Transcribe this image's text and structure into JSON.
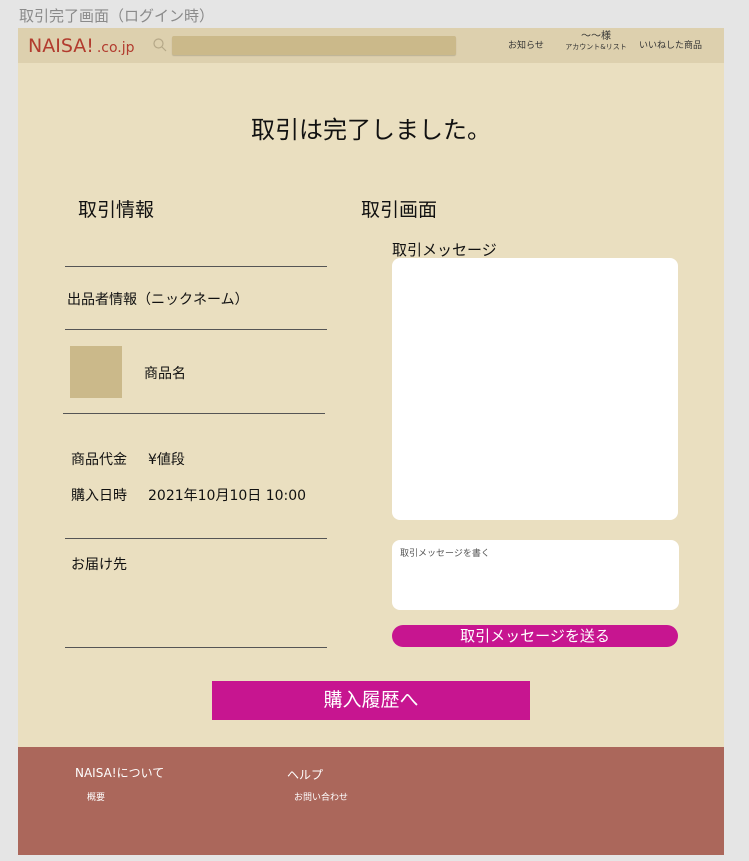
{
  "frame_label": "取引完了画面（ログイン時）",
  "header": {
    "logo": "NAISA!",
    "logo_tld": ".co.jp",
    "search_placeholder": "",
    "news": "お知らせ",
    "account_name": "〜〜様",
    "account_sub": "アカウント&リスト",
    "likes": "いいねした商品"
  },
  "main": {
    "title": "取引は完了しました。"
  },
  "left": {
    "title": "取引情報",
    "seller_info": "出品者情報（ニックネーム）",
    "product_name": "商品名",
    "price_label": "商品代金",
    "price_value": "¥値段",
    "date_label": "購入日時",
    "date_value": "2021年10月10日 10:00",
    "delivery_label": "お届け先"
  },
  "right": {
    "title": "取引画面",
    "message_label": "取引メッセージ",
    "message_placeholder": "取引メッセージを書く",
    "send_button": "取引メッセージを送る"
  },
  "history_button": "購入履歴へ",
  "footer": {
    "col1_title": "NAISA!について",
    "col1_link": "概要",
    "col2_title": "ヘルプ",
    "col2_link": "お問い合わせ"
  },
  "colors": {
    "page_bg": "#eadfc0",
    "header_bg": "#ddd0ae",
    "accent": "#c71590",
    "footer_bg": "#ab675b",
    "logo": "#b23b2e"
  }
}
